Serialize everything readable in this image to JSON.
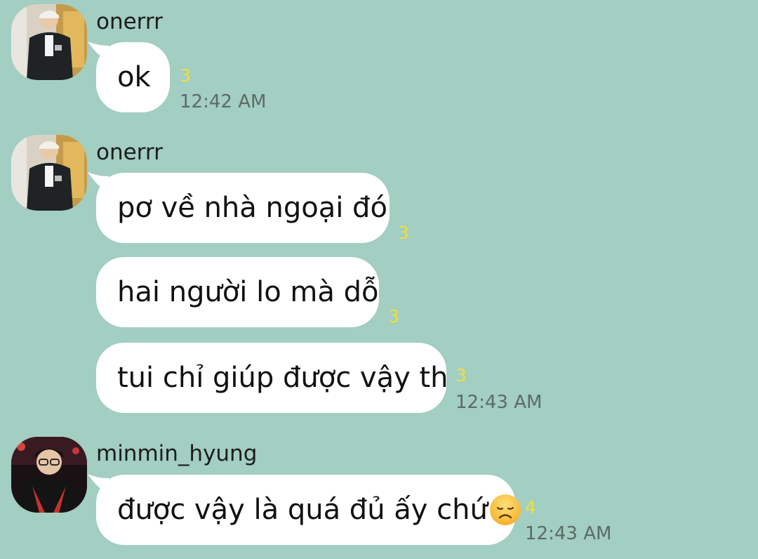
{
  "messages": [
    {
      "sender": "onerrr",
      "text": "ok",
      "read_count": "3",
      "time": "12:42 AM"
    },
    {
      "sender": "onerrr",
      "text": "pơ về nhà ngoại đó",
      "read_count": "3",
      "time": ""
    },
    {
      "sender": "",
      "text": "hai người lo mà dỗ",
      "read_count": "3",
      "time": ""
    },
    {
      "sender": "",
      "text": "tui chỉ giúp được vậy th",
      "read_count": "3",
      "time": "12:43 AM"
    },
    {
      "sender": "minmin_hyung",
      "text": "được vậy là quá đủ ấy chứ",
      "emoji": "disappointed-face",
      "read_count": "4",
      "time": "12:43 AM"
    }
  ],
  "colors": {
    "background": "#A3CEC2",
    "bubble": "#FFFFFF",
    "read_count": "#F1E03A",
    "timestamp": "#5B6B66"
  }
}
